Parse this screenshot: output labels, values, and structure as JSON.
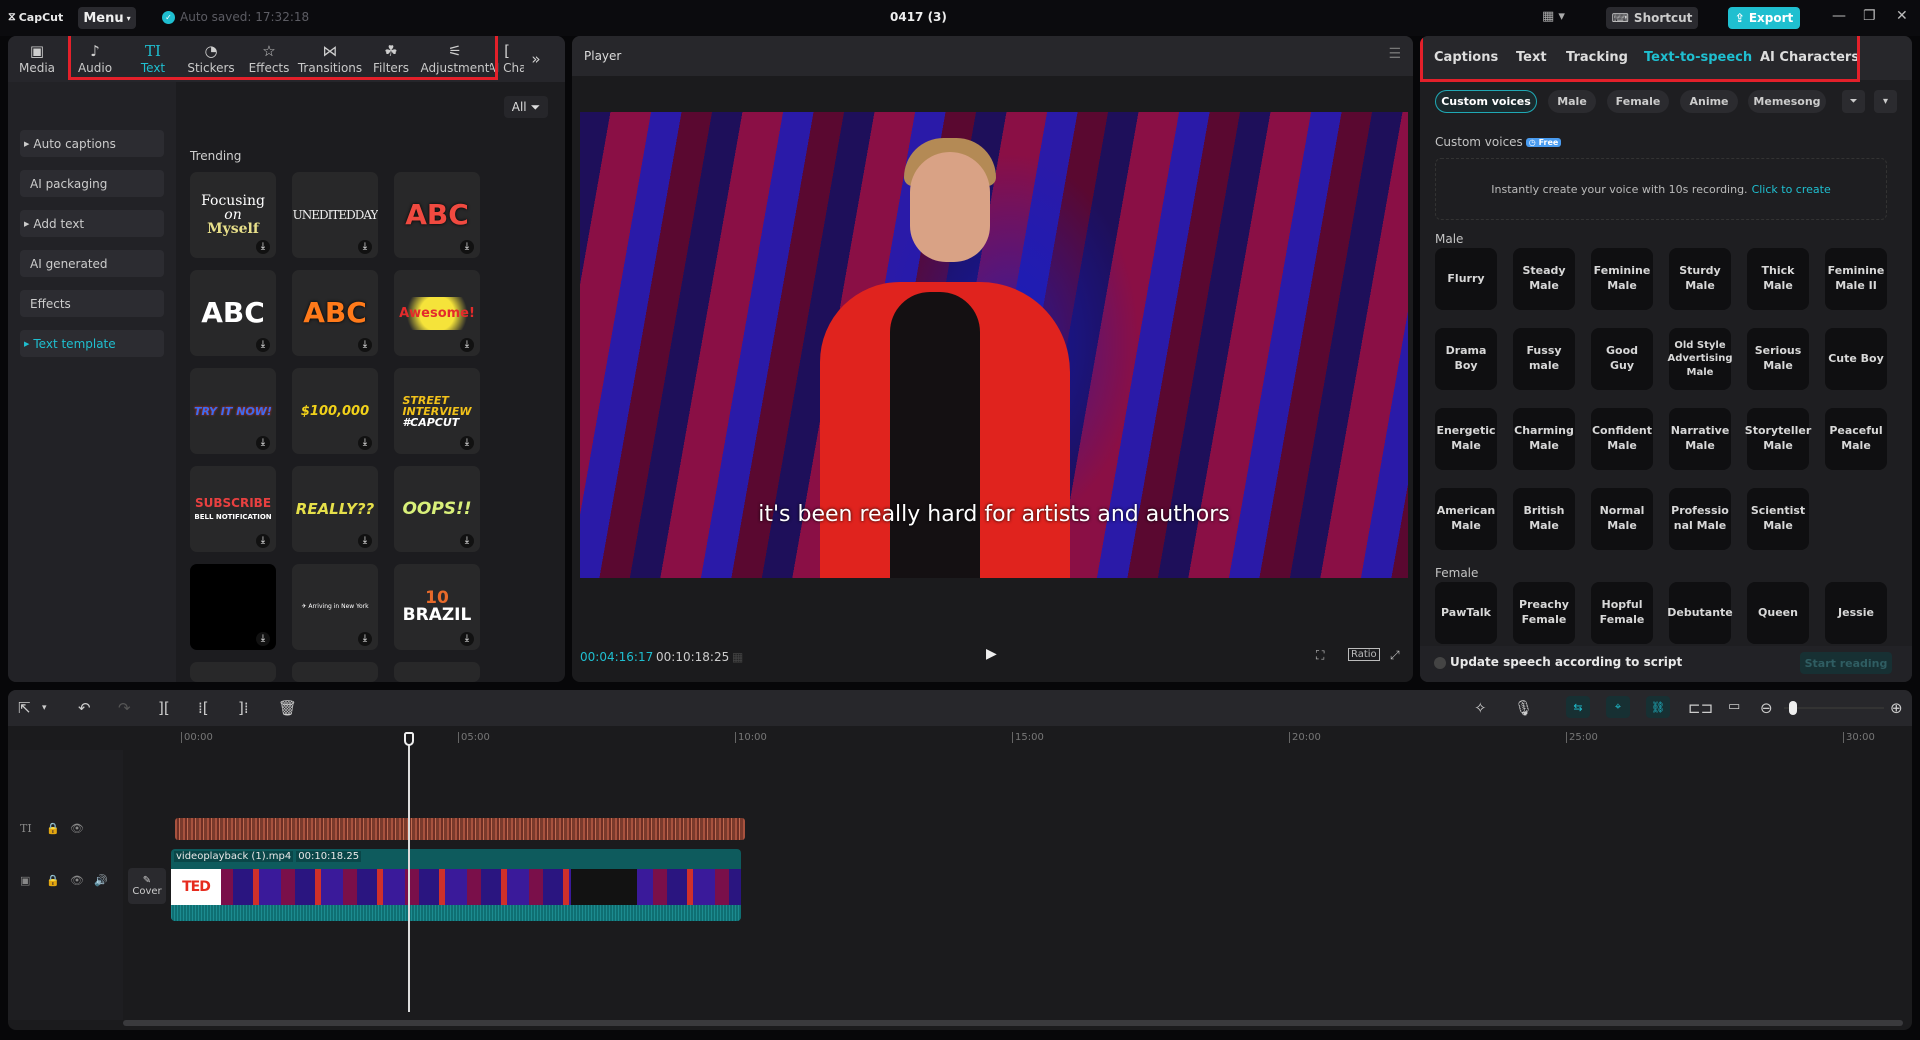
{
  "app": {
    "logo": "CapCut",
    "menu_label": "Menu",
    "autosave": "Auto saved: 17:32:18",
    "project_title": "0417 (3)",
    "shortcut_label": "Shortcut",
    "export_label": "Export"
  },
  "left_tabs": [
    {
      "label": "Media",
      "icon": "media-icon"
    },
    {
      "label": "Audio",
      "icon": "audio-icon"
    },
    {
      "label": "Text",
      "icon": "text-icon"
    },
    {
      "label": "Stickers",
      "icon": "sticker-icon"
    },
    {
      "label": "Effects",
      "icon": "effects-icon"
    },
    {
      "label": "Transitions",
      "icon": "transitions-icon"
    },
    {
      "label": "Filters",
      "icon": "filters-icon"
    },
    {
      "label": "Adjustment",
      "icon": "adjustment-icon"
    },
    {
      "label": "AI Cha",
      "icon": "ai-characters-icon"
    }
  ],
  "sidebar": {
    "items": [
      {
        "label": "Auto captions",
        "expandable": true
      },
      {
        "label": "AI packaging",
        "expandable": false
      },
      {
        "label": "Add text",
        "expandable": true
      },
      {
        "label": "AI generated",
        "expandable": false
      },
      {
        "label": "Effects",
        "expandable": false
      },
      {
        "label": "Text template",
        "expandable": true,
        "active": true
      }
    ]
  },
  "templates": {
    "filter_label": "All",
    "section_title": "Trending",
    "items": [
      "Focusing on Myself",
      "UNEDITEDDAY",
      "ABC",
      "ABC",
      "ABC",
      "Awesome!",
      "TRY IT NOW!",
      "$100,000",
      "STREET INTERVIEW #CAPCUT",
      "SUBSCRIBE BELL NOTIFICATION",
      "REALLY??",
      "OOPS!!",
      "",
      "Arriving in New York",
      "10 BRAZIL"
    ]
  },
  "player": {
    "title": "Player",
    "subtitle": "it's been really hard for artists and authors",
    "current_time": "00:04:16:17",
    "total_time": "00:10:18:25",
    "ratio_label": "Ratio"
  },
  "right_tabs": [
    "Captions",
    "Text",
    "Tracking",
    "Text-to-speech",
    "AI Characters"
  ],
  "tts": {
    "chips": [
      "Custom voices",
      "Male",
      "Female",
      "Anime",
      "Memesong"
    ],
    "custom_title": "Custom voices",
    "free_badge": "Free",
    "create_text": "Instantly create your voice with 10s recording.",
    "create_link": "Click to create",
    "male_title": "Male",
    "male_voices": [
      "Flurry",
      "Steady Male",
      "Feminine Male",
      "Sturdy Male",
      "Thick Male",
      "Feminine Male II",
      "Drama Boy",
      "Fussy male",
      "Good Guy",
      "Old Style Advertising Male",
      "Serious Male",
      "Cute Boy",
      "Energetic Male",
      "Charming Male",
      "Confident Male",
      "Narrative Male",
      "Storyteller Male",
      "Peaceful Male",
      "American Male",
      "British Male",
      "Normal Male",
      "Professio nal Male",
      "Scientist Male"
    ],
    "female_title": "Female",
    "female_voices": [
      "PawTalk",
      "Preachy Female",
      "Hopful Female",
      "Debutante",
      "Queen",
      "Jessie"
    ],
    "update_label": "Update speech according to script",
    "start_label": "Start reading"
  },
  "timeline": {
    "ruler": [
      "00:00",
      "05:00",
      "10:00",
      "15:00",
      "20:00",
      "25:00",
      "30:00"
    ],
    "clip_name": "videoplayback (1).mp4",
    "clip_duration": "00:10:18.25",
    "cover_label": "Cover",
    "zoom_level": 0.05
  }
}
